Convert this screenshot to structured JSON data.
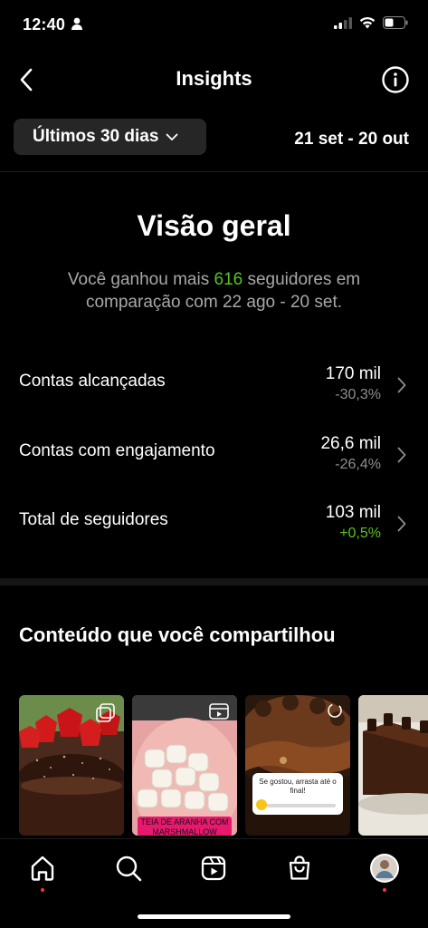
{
  "status_bar": {
    "time": "12:40"
  },
  "nav": {
    "title": "Insights"
  },
  "range": {
    "selected": "Últimos 30 dias",
    "dates": "21 set - 20 out"
  },
  "overview": {
    "title": "Visão geral",
    "text_before": "Você ganhou mais ",
    "gained": "616",
    "text_after": " seguidores em comparação com 22 ago - 20 set."
  },
  "metrics": [
    {
      "label": "Contas alcançadas",
      "value": "170 mil",
      "change": "-30,3%",
      "positive": false
    },
    {
      "label": "Contas com engajamento",
      "value": "26,6 mil",
      "change": "-26,4%",
      "positive": false
    },
    {
      "label": "Total de seguidores",
      "value": "103 mil",
      "change": "+0,5%",
      "positive": true
    }
  ],
  "content": {
    "title": "Conteúdo que você compartilhou",
    "thumbnails": [
      {
        "type": "carousel-post",
        "overlay_text": ""
      },
      {
        "type": "reel",
        "overlay_text": "TEIA DE ARANHA COM MARSHMALLOW"
      },
      {
        "type": "story",
        "overlay_text": "Se gostou, arrasta até o final!"
      },
      {
        "type": "post",
        "overlay_text": ""
      }
    ]
  },
  "tab_bar": {
    "tabs": [
      {
        "name": "home",
        "active": true,
        "notify": true
      },
      {
        "name": "search",
        "active": false,
        "notify": false
      },
      {
        "name": "reels",
        "active": false,
        "notify": false
      },
      {
        "name": "shop",
        "active": false,
        "notify": false
      },
      {
        "name": "profile",
        "active": false,
        "notify": true
      }
    ]
  },
  "colors": {
    "background": "#000000",
    "positive": "#58c322",
    "notification": "#ff3040",
    "chip": "#262626"
  }
}
